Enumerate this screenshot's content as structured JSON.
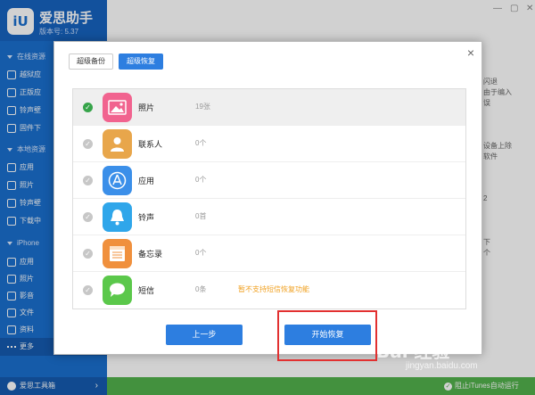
{
  "brand": {
    "logo_text": "iU",
    "name": "爱思助手",
    "version": "版本号: 5.37"
  },
  "sidebar": {
    "sections": [
      {
        "label": "在线资源",
        "items": [
          "越狱应",
          "正版应",
          "铃声壁",
          "固件下"
        ]
      },
      {
        "label": "本地资源",
        "items": [
          "应用",
          "照片",
          "铃声壁",
          "下载中"
        ]
      },
      {
        "label": "iPhone",
        "items": [
          "应用",
          "照片",
          "影音",
          "文件",
          "资料",
          "更多"
        ]
      }
    ],
    "toolbox": "爱思工具箱"
  },
  "background_right": [
    "闪退",
    "由于编入",
    "误",
    "设备上除",
    "软件",
    "2",
    "下",
    "个"
  ],
  "statusbar": {
    "itunes": "阻止iTunes自动运行"
  },
  "modal": {
    "tabs": {
      "backup": "超级备份",
      "restore": "超级恢复"
    },
    "close": "×",
    "rows": [
      {
        "label": "照片",
        "count": "19张",
        "note": "",
        "color": "#f1638f",
        "icon": "photo-icon",
        "selected": true
      },
      {
        "label": "联系人",
        "count": "0个",
        "note": "",
        "color": "#e8a64b",
        "icon": "contact-icon",
        "selected": false
      },
      {
        "label": "应用",
        "count": "0个",
        "note": "",
        "color": "#3b8fe9",
        "icon": "appstore-icon",
        "selected": false
      },
      {
        "label": "铃声",
        "count": "0首",
        "note": "",
        "color": "#2fa6ea",
        "icon": "bell-icon",
        "selected": false
      },
      {
        "label": "备忘录",
        "count": "0个",
        "note": "",
        "color": "#f0903d",
        "icon": "notes-icon",
        "selected": false
      },
      {
        "label": "短信",
        "count": "0条",
        "note": "暂不支持短信恢复功能",
        "color": "#5bc84b",
        "icon": "message-icon",
        "selected": false
      }
    ],
    "prev_label": "上一步",
    "start_label": "开始恢复"
  },
  "watermark": {
    "text": "Bai 经验",
    "url": "jingyan.baidu.com"
  }
}
